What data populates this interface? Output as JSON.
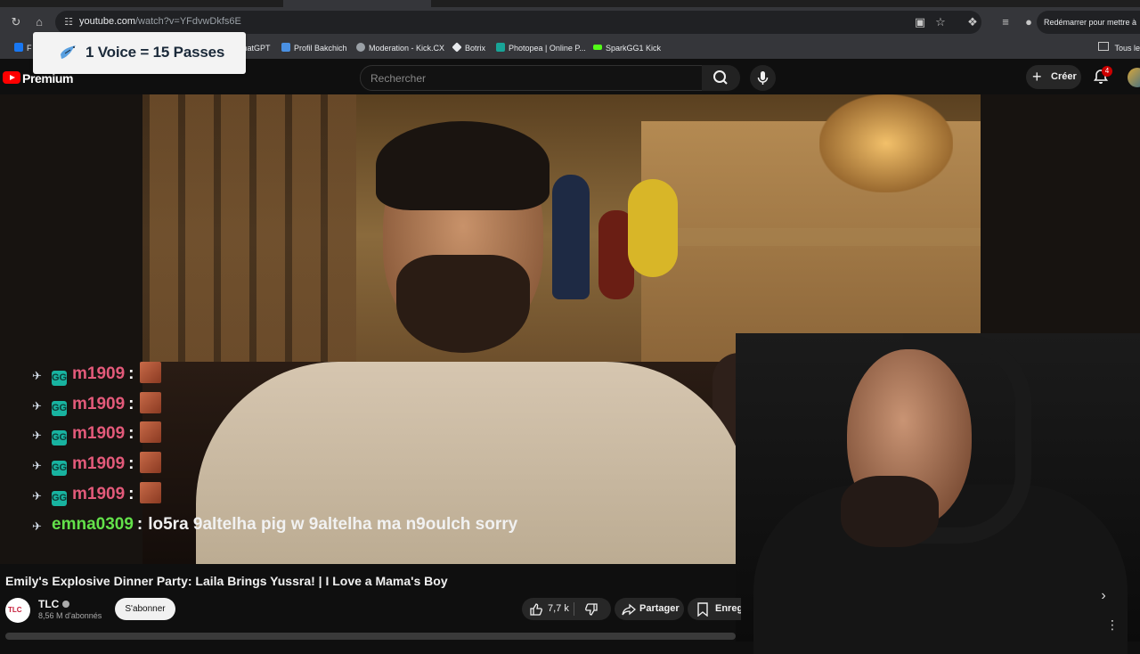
{
  "browser": {
    "url_host": "youtube.com",
    "url_path": "/watch?v=YFdvwDkfs6E",
    "restart_label": "Redémarrer pour mettre à",
    "bookmarks": [
      {
        "label": "F",
        "color": "#1877f2"
      },
      {
        "label": "ChatGPT",
        "color": "#ffffff"
      },
      {
        "label": "Profil Bakchich",
        "color": "#4a90e2"
      },
      {
        "label": "Moderation - Kick.CX",
        "color": "#e8eaed"
      },
      {
        "label": "Botrix",
        "color": "#e8eaed"
      },
      {
        "label": "Photopea | Online P...",
        "color": "#18a497"
      },
      {
        "label": "SparkGG1 Kick",
        "color": "#53fc18"
      }
    ],
    "all_bookmarks": "Tous le"
  },
  "promo": {
    "text": "1 Voice = 15 Passes"
  },
  "yt_header": {
    "logo_text": "Premium",
    "search_placeholder": "Rechercher",
    "create_label": "Créer",
    "notification_count": "4"
  },
  "chat": {
    "messages": [
      {
        "user": "m1909",
        "color": "#e35a7a",
        "text": ""
      },
      {
        "user": "m1909",
        "color": "#e35a7a",
        "text": ""
      },
      {
        "user": "m1909",
        "color": "#e35a7a",
        "text": ""
      },
      {
        "user": "m1909",
        "color": "#e35a7a",
        "text": ""
      },
      {
        "user": "m1909",
        "color": "#e35a7a",
        "text": ""
      },
      {
        "user": "emna0309",
        "color": "#63e14a",
        "text": "lo5ra 9altelha pig w 9altelha ma n9oulch sorry"
      }
    ]
  },
  "video": {
    "title": "Emily's Explosive Dinner Party: Laila Brings Yussra! | I Love a Mama's Boy",
    "channel_name": "TLC",
    "channel_avatar_text": "TLC",
    "subscribers": "8,56 M d'abonnés",
    "subscribe_label": "S'abonner",
    "likes": "7,7 k",
    "share_label": "Partager",
    "save_label": "Enregistrer"
  },
  "colors": {
    "youtube_red": "#ff0000",
    "bg": "#0f0f0f",
    "chip_bg": "#272727"
  }
}
